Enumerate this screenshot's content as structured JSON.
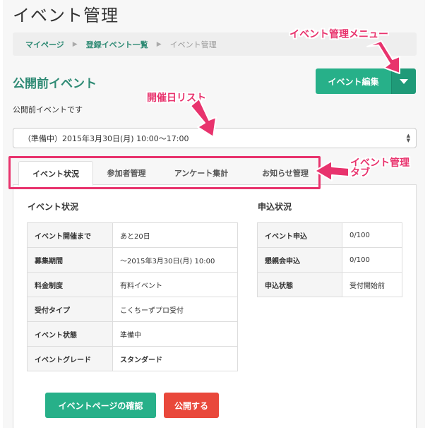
{
  "page": {
    "title": "イベント管理"
  },
  "breadcrumb": {
    "items": [
      "マイページ",
      "登録イベント一覧"
    ],
    "current": "イベント管理",
    "separator": "▶"
  },
  "section": {
    "title": "公開前イベント",
    "description": "公開前イベントです"
  },
  "edit_menu": {
    "label": "イベント編集",
    "dropdown_icon": "caret-down-icon"
  },
  "date_select": {
    "value": "（準備中）2015年3月30日(月) 10:00〜17:00"
  },
  "tabs": [
    {
      "label": "イベント状況",
      "active": true
    },
    {
      "label": "参加者管理",
      "active": false
    },
    {
      "label": "アンケート集計",
      "active": false
    },
    {
      "label": "お知らせ管理",
      "active": false
    }
  ],
  "event_status": {
    "title": "イベント状況",
    "rows": [
      {
        "key": "イベント開催まで",
        "value": "あと20日"
      },
      {
        "key": "募集期間",
        "value": "〜2015年3月30日(月) 10:00"
      },
      {
        "key": "料金制度",
        "value": "有料イベント"
      },
      {
        "key": "受付タイプ",
        "value": "こくちーずプロ受付"
      },
      {
        "key": "イベント状態",
        "value": "準備中"
      },
      {
        "key": "イベントグレード",
        "value": "スタンダード"
      }
    ]
  },
  "application_status": {
    "title": "申込状況",
    "rows": [
      {
        "key": "イベント申込",
        "value": "0/100"
      },
      {
        "key": "懇親会申込",
        "value": "0/100"
      },
      {
        "key": "申込状態",
        "value": "受付開始前"
      }
    ]
  },
  "actions": {
    "confirm_label": "イベントページの確認",
    "publish_label": "公開する"
  },
  "annotations": {
    "menu": "イベント管理メニュー",
    "date_list": "開催日リスト",
    "tab_line1": "イベント管理",
    "tab_line2": "タブ",
    "color": "#e8336d"
  },
  "colors": {
    "brand_green": "#27b089",
    "link_green": "#2e8a74",
    "danger_red": "#e9483b"
  }
}
